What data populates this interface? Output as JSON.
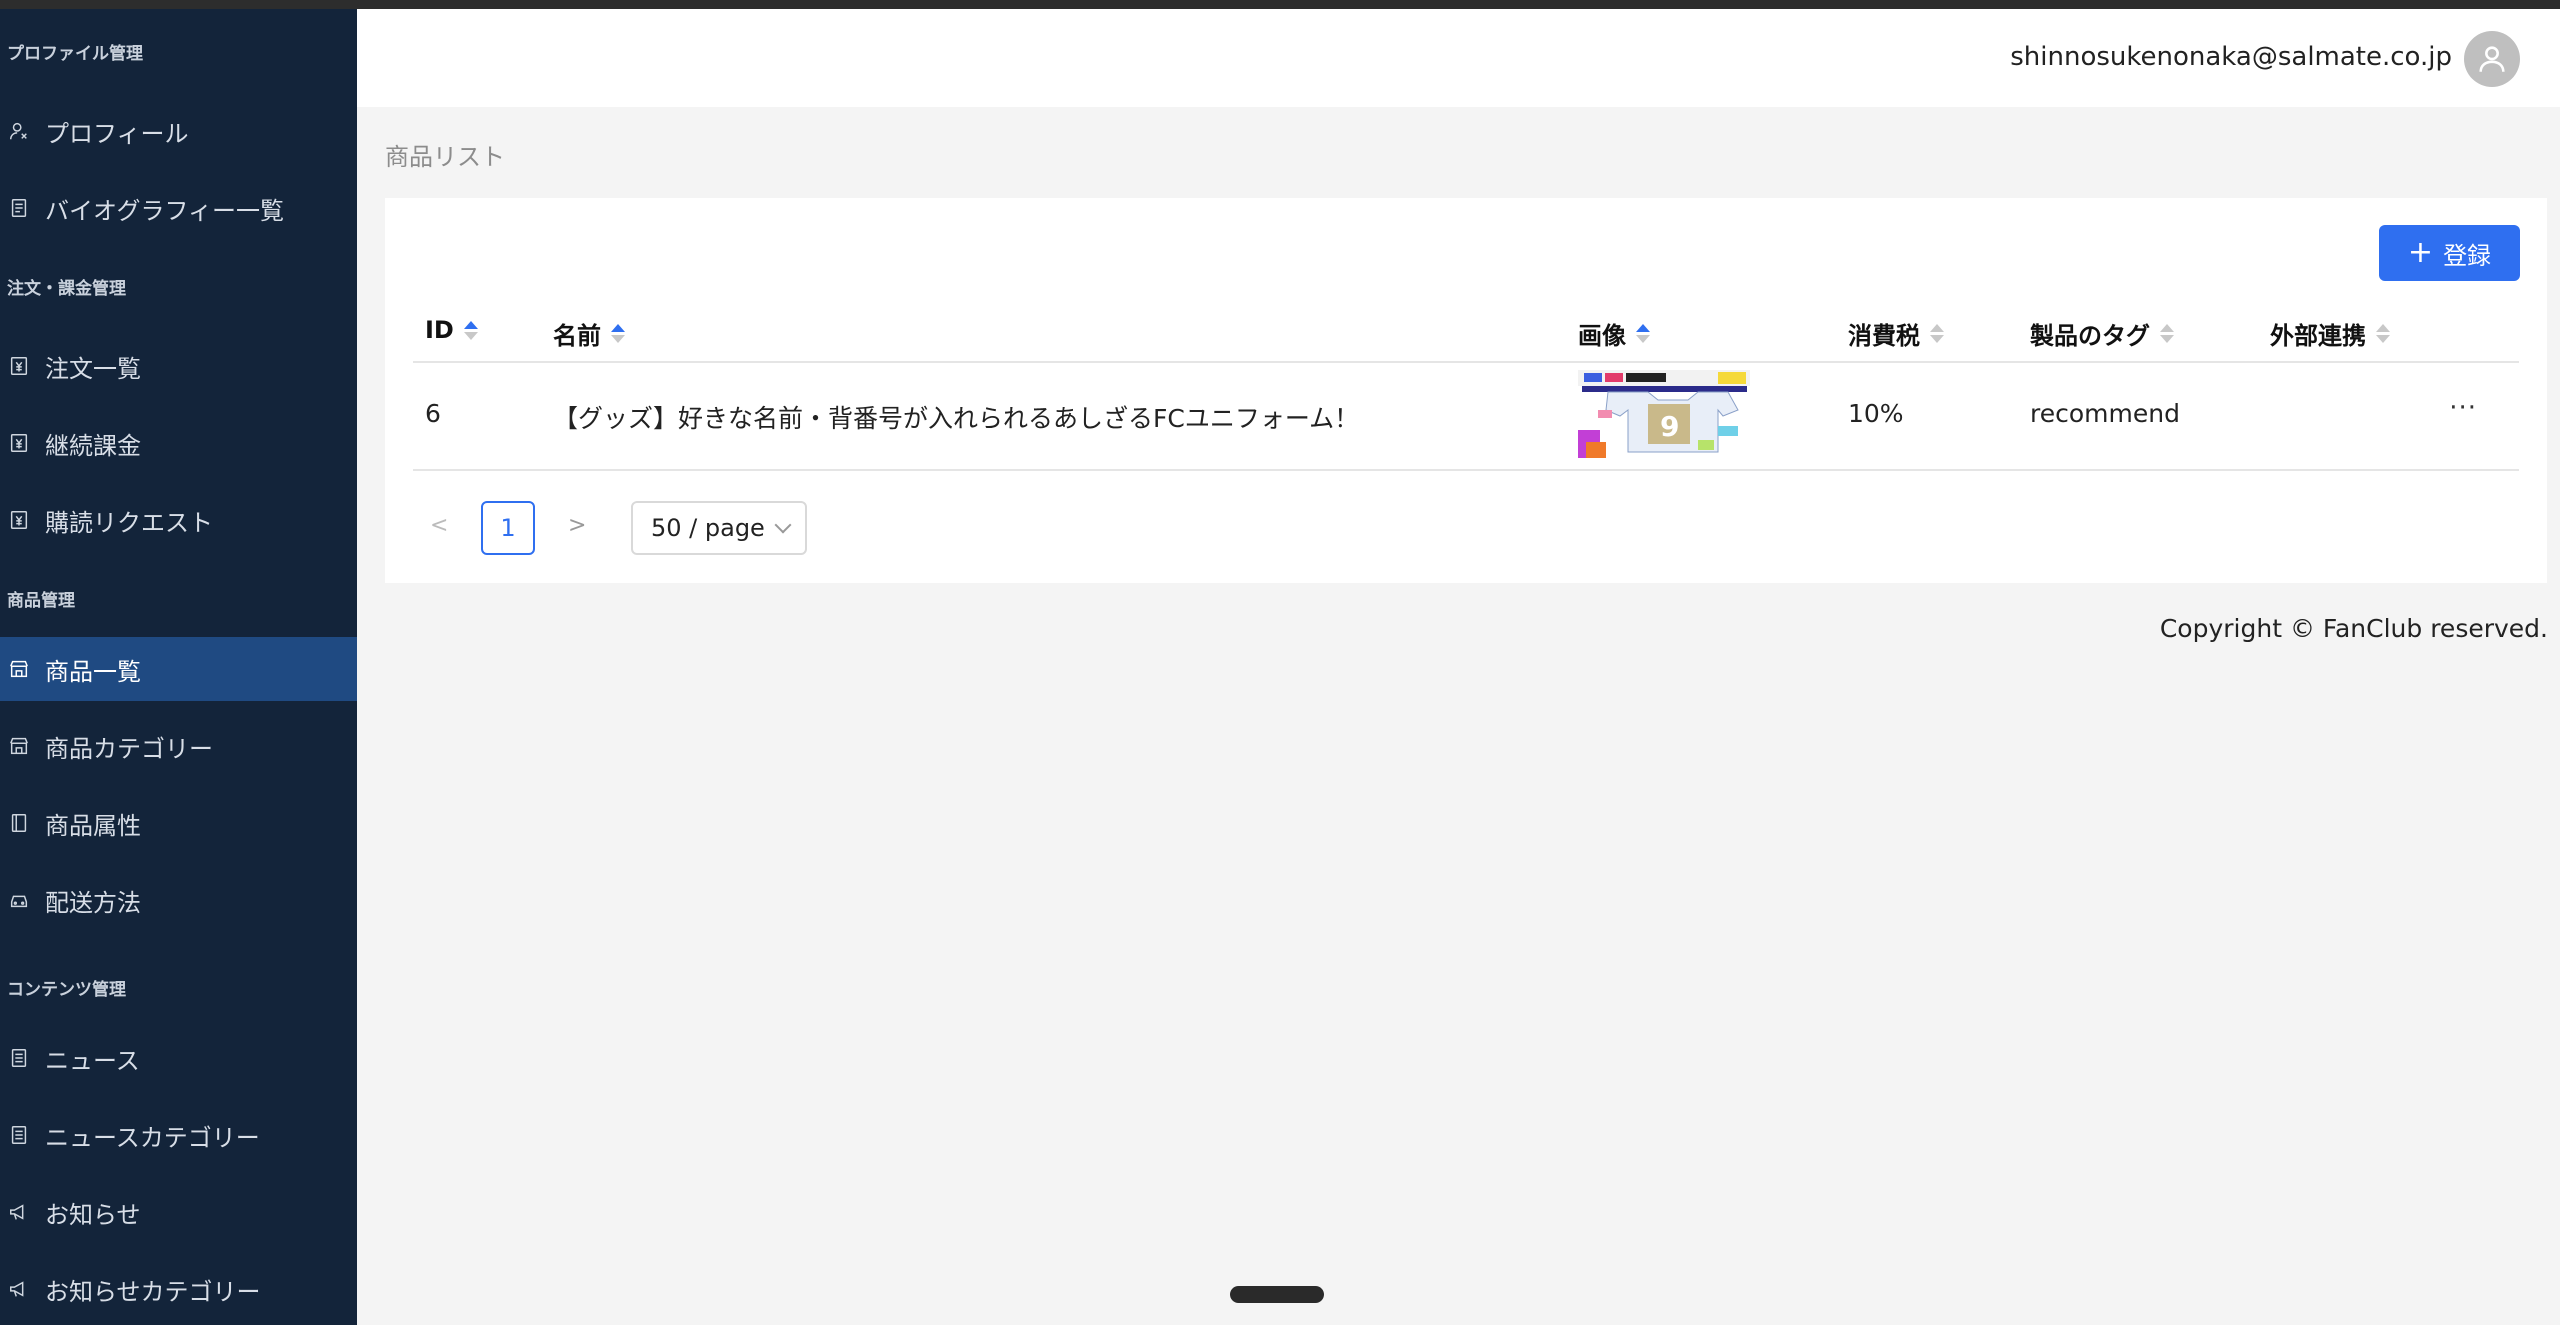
{
  "sidebar": {
    "sections": [
      {
        "title": "プロファイル管理",
        "items": [
          {
            "label": "プロフィール",
            "icon": "user-icon"
          },
          {
            "label": "バイオグラフィー一覧",
            "icon": "document-icon"
          }
        ]
      },
      {
        "title": "注文・課金管理",
        "items": [
          {
            "label": "注文一覧",
            "icon": "yen-receipt-icon"
          },
          {
            "label": "継続課金",
            "icon": "yen-receipt-icon"
          },
          {
            "label": "購読リクエスト",
            "icon": "yen-receipt-icon"
          }
        ]
      },
      {
        "title": "商品管理",
        "items": [
          {
            "label": "商品一覧",
            "icon": "shop-icon",
            "active": true
          },
          {
            "label": "商品カテゴリー",
            "icon": "shop-icon"
          },
          {
            "label": "商品属性",
            "icon": "book-icon"
          },
          {
            "label": "配送方法",
            "icon": "car-icon"
          }
        ]
      },
      {
        "title": "コンテンツ管理",
        "items": [
          {
            "label": "ニュース",
            "icon": "news-icon"
          },
          {
            "label": "ニュースカテゴリー",
            "icon": "news-icon"
          },
          {
            "label": "お知らせ",
            "icon": "megaphone-icon"
          },
          {
            "label": "お知らせカテゴリー",
            "icon": "megaphone-icon"
          }
        ]
      }
    ]
  },
  "header": {
    "user_email": "shinnosukenonaka@salmate.co.jp"
  },
  "breadcrumb": "商品リスト",
  "toolbar": {
    "add_label": "登録",
    "add_icon": "+"
  },
  "table": {
    "columns": [
      "ID",
      "名前",
      "画像",
      "消費税",
      "製品のタグ",
      "外部連携"
    ],
    "rows": [
      {
        "id": "6",
        "name": "【グッズ】好きな名前・背番号が入れられるあしざるFCユニフォーム！",
        "tax": "10%",
        "tag": "recommend",
        "external": "",
        "more": "···"
      }
    ]
  },
  "pagination": {
    "current_page": "1",
    "prev": "<",
    "next": ">",
    "page_size": "50 / page"
  },
  "footer": {
    "copyright": "Copyright © FanClub reserved."
  },
  "colors": {
    "sidebar_bg": "#13243a",
    "active_bg": "#1f4a82",
    "primary": "#2f6ff0"
  }
}
